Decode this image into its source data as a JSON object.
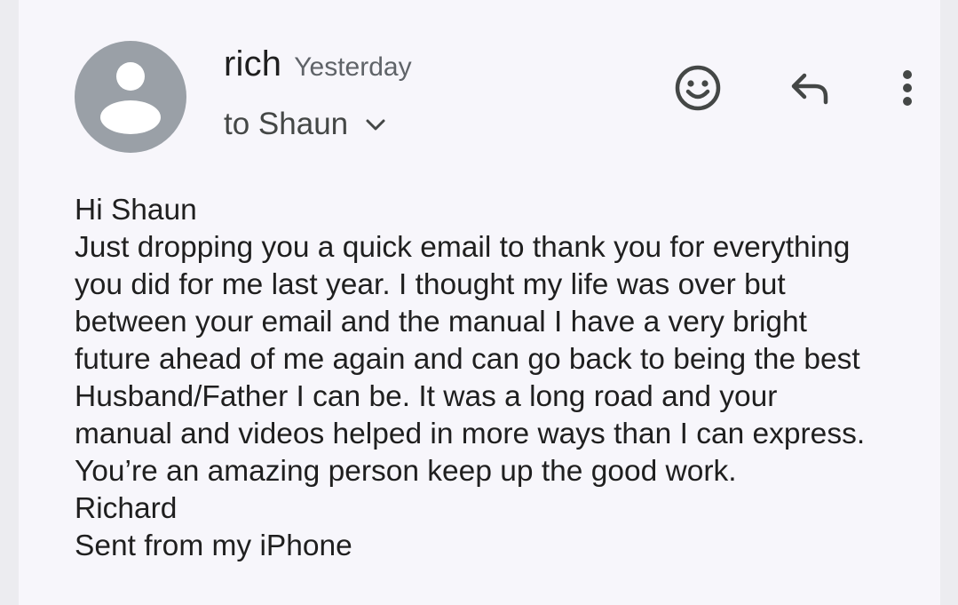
{
  "email": {
    "sender_name": "rich",
    "sent_time": "Yesterday",
    "recipient_label": "to Shaun",
    "icons": {
      "avatar": "person-icon",
      "emoji": "emoji-icon",
      "reply": "reply-icon",
      "more": "more-vert-icon",
      "expand": "chevron-down-icon"
    },
    "body_lines": [
      "Hi Shaun",
      "Just dropping you a quick email to thank you for everything",
      "you did for me last year. I thought my life was over but",
      "between your email and the manual I have a very bright",
      "future ahead of me again and can go back to being the best",
      "Husband/Father I can be. It was a long road and your",
      "manual and videos helped in more ways than I can express.",
      "You’re an amazing person keep up the good work.",
      "Richard",
      "Sent from my iPhone"
    ]
  },
  "colors": {
    "avatar_bg": "#9aa0a7",
    "card_bg": "#f7f6fb",
    "icon": "#444746",
    "text": "#1f1f1f",
    "secondary_text": "#5f6368"
  }
}
